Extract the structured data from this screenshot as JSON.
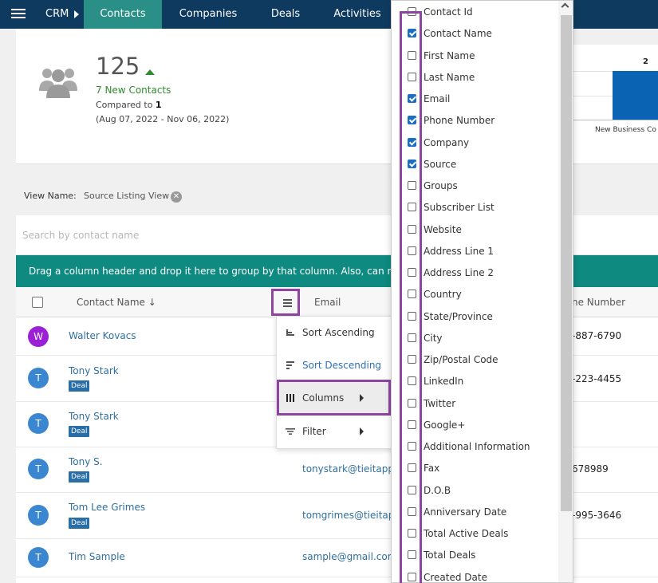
{
  "nav": {
    "brand": "CRM",
    "tabs": [
      {
        "label": "Contacts",
        "active": true
      },
      {
        "label": "Companies",
        "active": false
      },
      {
        "label": "Deals",
        "active": false
      },
      {
        "label": "Activities",
        "active": false
      }
    ]
  },
  "stats": {
    "count": "125",
    "new_contacts": "7 New Contacts",
    "compared_label": "Compared to",
    "compared_value": "1",
    "date_range": "(Aug 07, 2022 - Nov 06, 2022)"
  },
  "chart_data": {
    "type": "bar",
    "categories": [
      "New Business Co"
    ],
    "values": [
      2
    ],
    "data_labels": [
      "2"
    ]
  },
  "view": {
    "label": "View Name:",
    "value": "Source Listing View",
    "clear_icon": "close-circle-icon"
  },
  "grid": {
    "search_placeholder": "Search by contact name",
    "group_hint": "Drag a column header and drop it here to group by that column. Also, can re",
    "columns": {
      "contact_name": "Contact Name ↓",
      "email": "Email",
      "phone": "ne Number"
    },
    "rows": [
      {
        "initial": "W",
        "avatar_color": "#9b1fd6",
        "name": "Walter Kovacs",
        "deal": "",
        "email": "",
        "phone": "-887-6790"
      },
      {
        "initial": "T",
        "avatar_color": "#3b86d0",
        "name": "Tony Stark",
        "deal": "Deal",
        "email": "",
        "phone": "-223-4455"
      },
      {
        "initial": "T",
        "avatar_color": "#3b86d0",
        "name": "Tony Stark",
        "deal": "Deal",
        "email": "",
        "phone": ""
      },
      {
        "initial": "T",
        "avatar_color": "#3b86d0",
        "name": "Tony S.",
        "deal": "Deal",
        "email": "tonystark@tieitapp",
        "phone": "678989"
      },
      {
        "initial": "T",
        "avatar_color": "#3b86d0",
        "name": "Tom Lee Grimes",
        "deal": "Deal",
        "email": "tomgrimes@tieitap",
        "phone": "-995-3646"
      },
      {
        "initial": "T",
        "avatar_color": "#3b86d0",
        "name": "Tim Sample",
        "deal": "",
        "email": "sample@gmail.com",
        "phone": ""
      }
    ]
  },
  "column_menu": {
    "items": [
      {
        "label": "Sort Ascending",
        "icon": "sort-ascending-icon",
        "has_submenu": false
      },
      {
        "label": "Sort Descending",
        "icon": "sort-descending-icon",
        "has_submenu": false
      },
      {
        "label": "Columns",
        "icon": "columns-icon",
        "has_submenu": true
      },
      {
        "label": "Filter",
        "icon": "filter-icon",
        "has_submenu": true
      }
    ]
  },
  "column_chooser": {
    "items": [
      {
        "label": "Contact Id",
        "checked": false
      },
      {
        "label": "Contact Name",
        "checked": true
      },
      {
        "label": "First Name",
        "checked": false
      },
      {
        "label": "Last Name",
        "checked": false
      },
      {
        "label": "Email",
        "checked": true
      },
      {
        "label": "Phone Number",
        "checked": true
      },
      {
        "label": "Company",
        "checked": true
      },
      {
        "label": "Source",
        "checked": true
      },
      {
        "label": "Groups",
        "checked": false
      },
      {
        "label": "Subscriber List",
        "checked": false
      },
      {
        "label": "Website",
        "checked": false
      },
      {
        "label": "Address Line 1",
        "checked": false
      },
      {
        "label": "Address Line 2",
        "checked": false
      },
      {
        "label": "Country",
        "checked": false
      },
      {
        "label": "State/Province",
        "checked": false
      },
      {
        "label": "City",
        "checked": false
      },
      {
        "label": "Zip/Postal Code",
        "checked": false
      },
      {
        "label": "LinkedIn",
        "checked": false
      },
      {
        "label": "Twitter",
        "checked": false
      },
      {
        "label": "Google+",
        "checked": false
      },
      {
        "label": "Additional Information",
        "checked": false
      },
      {
        "label": "Fax",
        "checked": false
      },
      {
        "label": "D.O.B",
        "checked": false
      },
      {
        "label": "Anniversary Date",
        "checked": false
      },
      {
        "label": "Total Active Deals",
        "checked": false
      },
      {
        "label": "Total Deals",
        "checked": false
      },
      {
        "label": "Created Date",
        "checked": false
      }
    ]
  },
  "colors": {
    "nav_bg": "#0f3a5f",
    "accent_teal": "#0e8a80",
    "highlight_purple": "#8e44a1",
    "link_blue": "#2e6f9e"
  }
}
